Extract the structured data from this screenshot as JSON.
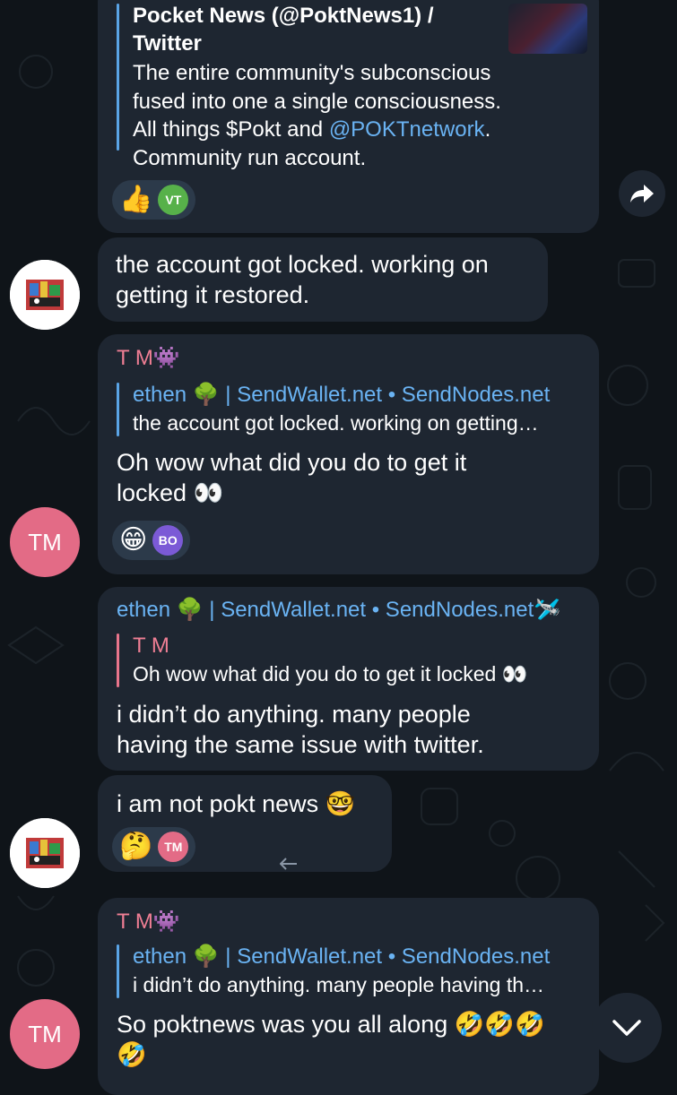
{
  "colors": {
    "background": "#0f1419",
    "bubble": "#1e2631",
    "link": "#6ab3f3",
    "pink_name": "#ef7e94",
    "avatar_tm": "#e36b86"
  },
  "msg1": {
    "preview_title_line1": "Pocket News (@PoktNews1) /",
    "preview_title_line2": "Twitter",
    "preview_line1": "The entire community's subconscious",
    "preview_line2": "fused into one a single consciousness.",
    "preview_line3_a": "All things $Pokt and ",
    "preview_line3_link": "@POKTnetwork",
    "preview_line3_b": ".",
    "preview_line4": "Community run account.",
    "reaction_emoji": "👍",
    "reaction_avatar": "VT"
  },
  "msg2": {
    "line1": "the account got locked. working on",
    "line2": "getting it restored."
  },
  "msg3": {
    "sender": "T M",
    "sender_emoji": "👾",
    "quote_author_a": "ethen ",
    "quote_author_emoji": "🌳",
    "quote_author_b": " | SendWallet.net • SendNodes.net",
    "quote_text": "the account got locked. working on getting…",
    "line1": "Oh wow what did you do to get it",
    "line2": "locked 👀",
    "reaction_emoji": "😁",
    "reaction_avatar": "BO",
    "avatar": "TM"
  },
  "msg4": {
    "sender_a": "ethen ",
    "sender_emoji": "🌳",
    "sender_b": " | SendWallet.net • SendNodes.net",
    "sender_emoji2": "🛩️",
    "quote_author": "T M",
    "quote_text": "Oh wow what did you do to get it locked 👀",
    "line1": "i didn’t do anything. many people",
    "line2": "having the same issue with twitter."
  },
  "msg5": {
    "line1": "i am not pokt news 🤓",
    "reaction_emoji": "🤔",
    "reaction_avatar": "TM"
  },
  "msg6": {
    "sender": "T M",
    "sender_emoji": "👾",
    "quote_author_a": "ethen ",
    "quote_author_emoji": "🌳",
    "quote_author_b": " | SendWallet.net • SendNodes.net",
    "quote_text": "i didn’t do anything. many people having th…",
    "line1": "So poktnews was you all along 🤣🤣🤣",
    "line2": "🤣",
    "avatar": "TM"
  },
  "icons": {
    "forward": "forward-arrow-icon",
    "scroll_down": "chevron-down-icon",
    "reply": "reply-arrow-icon"
  }
}
